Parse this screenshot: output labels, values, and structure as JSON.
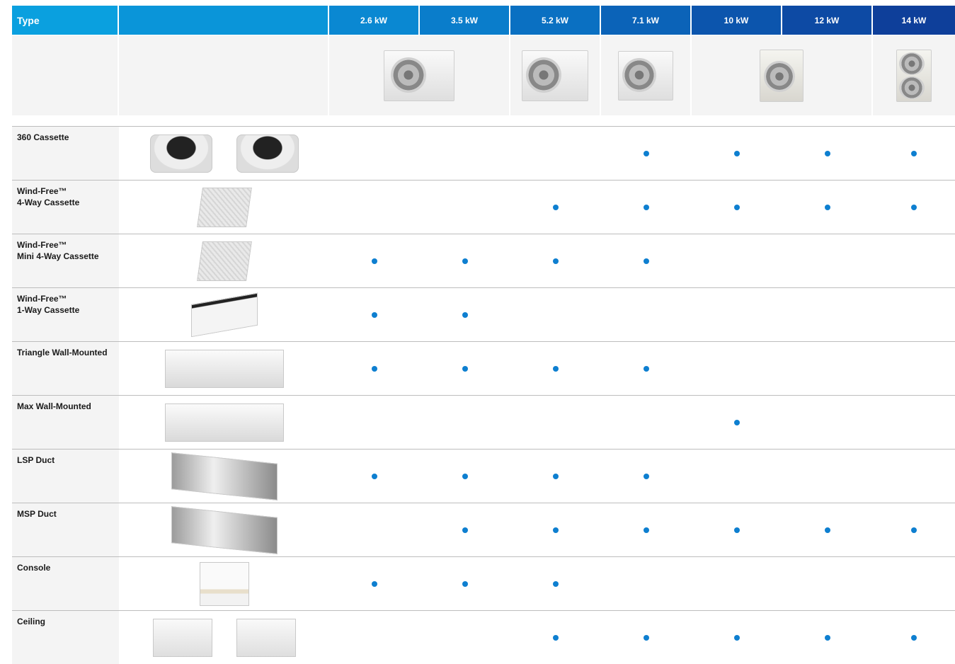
{
  "colors": {
    "header": [
      "#0aa0df",
      "#0a95d9",
      "#0a88d2",
      "#0a7dcb",
      "#0a70c2",
      "#0b63b8",
      "#0c55ad",
      "#0d4aa4",
      "#0e3f9a"
    ],
    "dot": "#0e7fd0"
  },
  "header": {
    "type_label": "Type",
    "capacities": [
      "2.6 kW",
      "3.5 kW",
      "5.2 kW",
      "7.1 kW",
      "10 kW",
      "12 kW",
      "14 kW"
    ]
  },
  "outdoor_units": [
    {
      "column": "2.6 kW",
      "image": "outdoor-unit-small-image"
    },
    {
      "column": "5.2 kW",
      "image": "outdoor-unit-medium-image"
    },
    {
      "column": "7.1 kW",
      "image": "outdoor-unit-medium-image"
    },
    {
      "column": "10 kW",
      "image": "outdoor-unit-tall-image"
    },
    {
      "column": "14 kW",
      "image": "outdoor-unit-double-fan-image"
    }
  ],
  "rows": [
    {
      "name": "360 Cassette",
      "images": [
        "round-cassette-image",
        "round-cassette-image"
      ],
      "available": [
        false,
        false,
        false,
        true,
        true,
        true,
        true
      ]
    },
    {
      "name": "Wind-Free™\n4-Way Cassette",
      "images": [
        "square-cassette-image"
      ],
      "available": [
        false,
        false,
        true,
        true,
        true,
        true,
        true
      ]
    },
    {
      "name": "Wind-Free™\nMini 4-Way Cassette",
      "images": [
        "square-cassette-image"
      ],
      "available": [
        true,
        true,
        true,
        true,
        false,
        false,
        false
      ]
    },
    {
      "name": "Wind-Free™\n1-Way Cassette",
      "images": [
        "one-way-cassette-image"
      ],
      "available": [
        true,
        true,
        false,
        false,
        false,
        false,
        false
      ]
    },
    {
      "name": "Triangle Wall-Mounted",
      "images": [
        "wall-mounted-image"
      ],
      "available": [
        true,
        true,
        true,
        true,
        false,
        false,
        false
      ]
    },
    {
      "name": "Max Wall-Mounted",
      "images": [
        "wall-mounted-image"
      ],
      "available": [
        false,
        false,
        false,
        false,
        true,
        false,
        false
      ]
    },
    {
      "name": "LSP Duct",
      "images": [
        "duct-unit-image"
      ],
      "available": [
        true,
        true,
        true,
        true,
        false,
        false,
        false
      ]
    },
    {
      "name": "MSP Duct",
      "images": [
        "duct-unit-image"
      ],
      "available": [
        false,
        true,
        true,
        true,
        true,
        true,
        true
      ]
    },
    {
      "name": "Console",
      "images": [
        "console-unit-image"
      ],
      "available": [
        true,
        true,
        true,
        false,
        false,
        false,
        false
      ]
    },
    {
      "name": "Ceiling",
      "images": [
        "ceiling-unit-image",
        "ceiling-unit-image"
      ],
      "available": [
        false,
        false,
        true,
        true,
        true,
        true,
        true
      ]
    }
  ]
}
